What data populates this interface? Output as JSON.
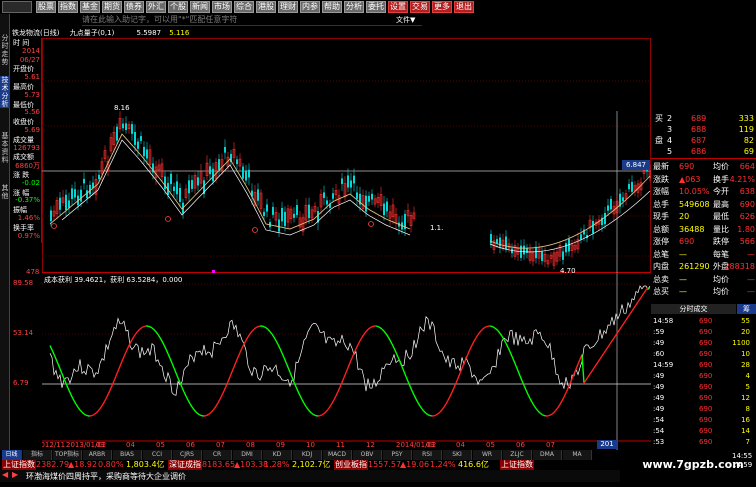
{
  "toolbar": {
    "buttons": [
      "股票",
      "指数",
      "基金",
      "期货",
      "债券",
      "外汇",
      "个股",
      "新闻",
      "市场",
      "综合",
      "港股",
      "理财",
      "内参",
      "帮助",
      "分析",
      "委托",
      "设置",
      "交易",
      "更多",
      "退出"
    ],
    "file_menu": "文件▼"
  },
  "search": {
    "placeholder": "请在此输入助记字，可以用\"*\"匹配任意字符"
  },
  "left_tabs": [
    "分时走势",
    "技术分析",
    "基本资料",
    "其他"
  ],
  "title_bar": {
    "stock": "铁龙物流(日线)",
    "indicator": "九点量子(0,1)",
    "ind_vals": [
      "5.5987",
      "5.116"
    ]
  },
  "info_panel": {
    "rows": [
      {
        "label": "时 间",
        "value": ""
      },
      {
        "label": "",
        "value": "2014"
      },
      {
        "label": "",
        "value": "06/27"
      },
      {
        "label": "开盘价",
        "value": ""
      },
      {
        "label": "",
        "value": "5.61"
      },
      {
        "label": "最高价",
        "value": ""
      },
      {
        "label": "",
        "value": "5.73"
      },
      {
        "label": "最低价",
        "value": ""
      },
      {
        "label": "",
        "value": "5.56"
      },
      {
        "label": "收盘价",
        "value": ""
      },
      {
        "label": "",
        "value": "5.69"
      },
      {
        "label": "成交量",
        "value": ""
      },
      {
        "label": "",
        "value": "126793"
      },
      {
        "label": "成交额",
        "value": ""
      },
      {
        "label": "",
        "value": "6860万"
      },
      {
        "label": "涨 跌",
        "value": ""
      },
      {
        "label": "",
        "value": "-0.02"
      },
      {
        "label": "涨 幅",
        "value": ""
      },
      {
        "label": "",
        "value": "-0.37%"
      },
      {
        "label": "振幅",
        "value": ""
      },
      {
        "label": "",
        "value": "1.46%"
      },
      {
        "label": "换手率",
        "value": ""
      },
      {
        "label": "",
        "value": "0.97%"
      }
    ]
  },
  "chart_data": [
    {
      "type": "line",
      "title": "",
      "annotations": [
        "8.16",
        "4.70",
        "6.847",
        "1.1."
      ],
      "ylim": [
        4.7,
        8.4
      ],
      "note": "candlestick price chart"
    },
    {
      "type": "line",
      "title": "成本获利 39.4621，获利 63.5284，0.000",
      "ylabels": [
        "89.58",
        "53.14",
        "6.79"
      ],
      "xlabels": [
        "2012/11",
        "2013/01/02",
        "03",
        "04",
        "05",
        "06",
        "07",
        "08",
        "09",
        "10",
        "11",
        "12",
        "2014/01/02",
        "03",
        "04",
        "05",
        "06",
        "07"
      ],
      "ylim": [
        0,
        100
      ]
    }
  ],
  "axis_labels": {
    "price_bottom": "478",
    "price_side": "6.847",
    "vol_side": "201"
  },
  "right_panel": {
    "orders": [
      {
        "side": "买",
        "lvl": "2",
        "price": "689",
        "vol": "333"
      },
      {
        "side": "",
        "lvl": "3",
        "price": "688",
        "vol": "119"
      },
      {
        "side": "盘",
        "lvl": "4",
        "price": "687",
        "vol": "82"
      },
      {
        "side": "",
        "lvl": "5",
        "price": "686",
        "vol": "69"
      }
    ],
    "stats": [
      {
        "l": "最新",
        "v": "690",
        "l2": "均价",
        "v2": "664"
      },
      {
        "l": "涨跌",
        "v": "▲063",
        "l2": "换手",
        "v2": "4.21%"
      },
      {
        "l": "涨幅",
        "v": "10.05%",
        "l2": "今开",
        "v2": "638"
      },
      {
        "l": "总手",
        "v": "549608",
        "l2": "最高",
        "v2": "690"
      },
      {
        "l": "现手",
        "v": "20",
        "l2": "最低",
        "v2": "626"
      },
      {
        "l": "总额",
        "v": "36488",
        "l2": "量比",
        "v2": "1.80"
      },
      {
        "l": "涨停",
        "v": "690",
        "l2": "跌停",
        "v2": "566"
      },
      {
        "l": "总笔",
        "v": "—",
        "l2": "每笔",
        "v2": "—"
      },
      {
        "l": "内盘",
        "v": "261290",
        "l2": "外盘",
        "v2": "288318"
      },
      {
        "l": "总卖",
        "v": "—",
        "l2": "均价",
        "v2": "—"
      },
      {
        "l": "总买",
        "v": "—",
        "l2": "均价",
        "v2": "—"
      }
    ],
    "ticks_header": "分时成交",
    "ticks_tab": "筹",
    "ticks": [
      {
        "t": "14:58",
        "p": "690",
        "v": "55"
      },
      {
        "t": ":59",
        "p": "690",
        "v": "20"
      },
      {
        "t": ":49",
        "p": "690",
        "v": "1100"
      },
      {
        "t": ":60",
        "p": "690",
        "v": "10"
      },
      {
        "t": "14:59",
        "p": "690",
        "v": "28"
      },
      {
        "t": ":49",
        "p": "690",
        "v": "4"
      },
      {
        "t": ":49",
        "p": "690",
        "v": "5"
      },
      {
        "t": ":49",
        "p": "690",
        "v": "12"
      },
      {
        "t": ":49",
        "p": "690",
        "v": "8"
      },
      {
        "t": ":54",
        "p": "690",
        "v": "16"
      },
      {
        "t": ":54",
        "p": "690",
        "v": "14"
      },
      {
        "t": ":53",
        "p": "690",
        "v": "7"
      }
    ],
    "ticks_bottom": [
      "14:55",
      "14:59"
    ]
  },
  "bottom_tabs": [
    "日线",
    "指标",
    "TOP指标",
    "ARBR",
    "BIAS",
    "CCI",
    "CJRS",
    "CR",
    "DMI",
    "KD",
    "KDJ",
    "MACD",
    "OBV",
    "PSY",
    "RSI",
    "SKI",
    "WR",
    "ZLJC",
    "DMA",
    "MA"
  ],
  "status_bar": {
    "items": [
      {
        "name": "上证指数",
        "val": "2382.79",
        "chg": "▲18.92",
        "pct": "0.80%",
        "amt": "1,803.4亿"
      },
      {
        "name": "深证成指",
        "val": "8183.65",
        "chg": "▲103.38",
        "pct": "1.28%",
        "amt": "2,102.7亿"
      },
      {
        "name": "创业板指",
        "val": "1557.57",
        "chg": "▲19.06",
        "pct": "1.24%",
        "amt": "416.6亿"
      },
      {
        "name": "上证指数",
        "val": "",
        "chg": "",
        "pct": "",
        "amt": ""
      }
    ]
  },
  "news_ticker": "环渤海煤价四周持平，采购商等待大企业调价",
  "watermark": "www.7gpzb.com",
  "colors": {
    "up": "#ff3030",
    "down": "#00ff00",
    "line": "#ffffff",
    "grid": "#808080",
    "ma": "#e0c080"
  }
}
